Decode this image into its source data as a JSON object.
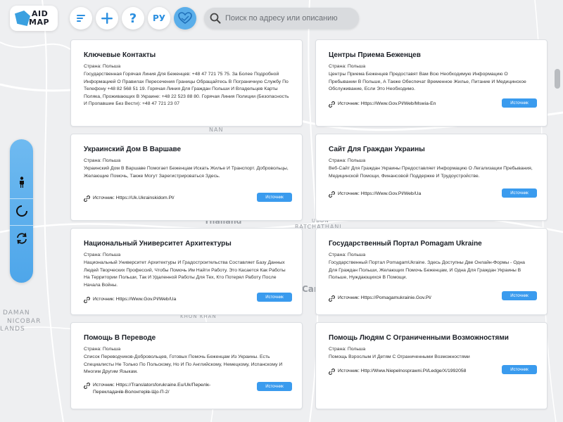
{
  "app": {
    "logo_line1": "AID",
    "logo_line2": "MAP",
    "lang_label": "РУ",
    "help_label": "?",
    "search_placeholder": "Поиск по адресу или описанию"
  },
  "map_labels": {
    "nan": "NAN",
    "thailand": "Thailand",
    "ubon": "UBON",
    "ratchathani": "RATCHATHANI",
    "cambodia_partial": "Cam",
    "khon_kaen": "KHON KHAN",
    "andaman_1": "DAMAN",
    "andaman_2": "NICOBAR",
    "andaman_3": "LANDS"
  },
  "source_prefix": "Источник:",
  "source_button": "Источник",
  "country_label": "Страна: Польша",
  "cards": [
    {
      "title": "Ключевые Контакты",
      "desc": "Государственная Горячая Линия Для Беженцев: +48 47 721 75 75. За Более Подробной Информацией О Правилах Пересечения Границы Обращайтесь В Пограничную Службу По Телефону +48 82 568 51 19. Горячая Линия Для Граждан Польши И Владельцев Карты Поляка, Проживающих В Украине: +48 22 523 88 80. Горячая Линия Полиции (Безопасность И Пропавшие Без Вести): +48 47 721 23 07",
      "source": ""
    },
    {
      "title": "Центры Приема Беженцев",
      "desc": "Центры Приема Беженцев Предоставят Вам Всю Необходимую Информацию О Пребывании В Польше, А Также Обеспечат Временное Жилье, Питание И Медицинское Обслуживание, Если Это Необходимо.",
      "source": "Https://Www.Gov.Pl/Web/Mswia-En"
    },
    {
      "title": "Украинский Дом В Варшаве",
      "desc": "Украинский Дом В Варшаве Помогает Беженцам Искать Жилье И Транспорт. Добровольцы, Желающие Помочь, Также Могут Зарегистрироваться Здесь.",
      "source": "Https://Uk.Ukrainskidom.Pl/"
    },
    {
      "title": "Сайт Для Граждан Украины",
      "desc": "Веб-Сайт Для Граждан Украины Предоставляет Информацию О Легализации Пребывания, Медицинской Помощи, Финансовой Поддержке И Трудоустройстве.",
      "source": "Https://Www.Gov.Pl/Web/Ua"
    },
    {
      "title": "Национальный Университет Архитектуры",
      "desc": "Национальный Университет Архитектуры И Градостроительства Составляет Базу Данных Людей Творческих Профессий, Чтобы Помочь Им Найти Работу. Это Касается Как Работы На Территории Польши, Так И Удаленной Работы Для Тех, Кто Потерял Работу После Начала Войны.",
      "source": "Https://Www.Gov.Pl/Web/Ua"
    },
    {
      "title": "Государственный Портал Pomagam Ukraine",
      "desc": "Государственный Портал PomagamUkraine. Здесь Доступны Две Онлайн-Формы - Одна Для Граждан Польши, Желающих Помочь Беженцам, И Одна Для Граждан Украины В Польше, Нуждающихся В Помощи.",
      "source": "Https://Pomagamukrainie.Gov.Pl/"
    },
    {
      "title": "Помощь В Переводе",
      "desc": "Список Переводчиков-Добровольцев, Готовых Помочь Беженцам Из Украины. Есть Специалисты Не Только По Польскому, Но И По Английскому, Немецкому, Испанскому И Многим Другим Языкам.",
      "source": "Https://Translatorsforukraine.Eu/Uk/Перелік-Перекладачів-Волонтерів-Що-П-2/"
    },
    {
      "title": "Помощь Людям С Ограниченными Возможностями",
      "desc": "Помощь Взрослым И Детям С Ограниченными Возможностями",
      "source": "Http://Www.Niepelnosprawni.Pl/Ledge/X/1992058"
    }
  ]
}
